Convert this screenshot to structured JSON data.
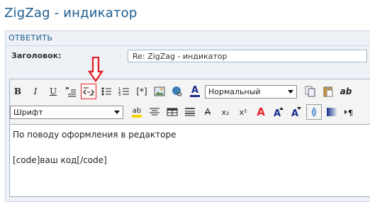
{
  "page": {
    "title": "ZigZag - индикатор"
  },
  "form": {
    "reply_label": "ОТВЕТИТЬ",
    "subject_label": "Заголовок:",
    "subject_value": "Re: ZigZag - индикатор"
  },
  "toolbar1": {
    "bold": "B",
    "italic": "I",
    "underline": "U",
    "bbcode": "[*]",
    "text_color": "A",
    "format_select": "Нормальный",
    "extra": "ab"
  },
  "toolbar2": {
    "font_select": "Шрифт",
    "highlight": "ab",
    "strike": "A",
    "subscript": "x₂",
    "superscript": "x²",
    "font_color": "A"
  },
  "editor": {
    "line1": "По поводу оформления в редакторе",
    "line2": "[code]ваш код[/code]"
  },
  "colors": {
    "title": "#1d5d8f",
    "arrow": "#e0262b",
    "panel": "#eef2f6"
  }
}
